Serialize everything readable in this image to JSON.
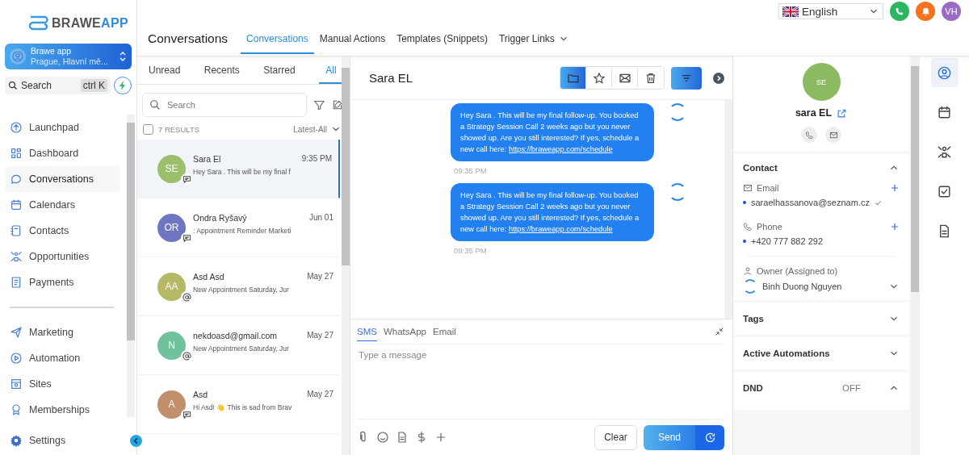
{
  "logo": {
    "main": "BRAWE",
    "accent": "APP"
  },
  "account": {
    "name": "Brawe app",
    "location": "Prague, Hlavní mě..."
  },
  "sidebar_search": {
    "placeholder": "Search",
    "shortcut": "ctrl K"
  },
  "nav_main": [
    {
      "label": "Launchpad",
      "selected": false
    },
    {
      "label": "Dashboard",
      "selected": false
    },
    {
      "label": "Conversations",
      "selected": true
    },
    {
      "label": "Calendars",
      "selected": false
    },
    {
      "label": "Contacts",
      "selected": false
    },
    {
      "label": "Opportunities",
      "selected": false
    },
    {
      "label": "Payments",
      "selected": false
    }
  ],
  "nav_secondary": [
    {
      "label": "Marketing",
      "selected": false
    },
    {
      "label": "Automation",
      "selected": false
    },
    {
      "label": "Sites",
      "selected": false
    },
    {
      "label": "Memberships",
      "selected": false
    }
  ],
  "settings": {
    "label": "Settings"
  },
  "header": {
    "title": "Conversations",
    "tabs": [
      {
        "label": "Conversations",
        "selected": true,
        "has_menu": false
      },
      {
        "label": "Manual Actions",
        "selected": false,
        "has_menu": false
      },
      {
        "label": "Templates (Snippets)",
        "selected": false,
        "has_menu": false
      },
      {
        "label": "Trigger Links",
        "selected": false,
        "has_menu": true
      }
    ]
  },
  "topbar": {
    "language": "English",
    "user_initials": "VH"
  },
  "list": {
    "tabs": [
      {
        "label": "Unread",
        "selected": false
      },
      {
        "label": "Recents",
        "selected": false
      },
      {
        "label": "Starred",
        "selected": false
      },
      {
        "label": "All",
        "selected": true
      }
    ],
    "search_placeholder": "Search",
    "select_all_checked": false,
    "results": "7 RESULTS",
    "sort": "Latest-All",
    "conversations": [
      {
        "initials": "SE",
        "name": "Sara El",
        "time": "9:35 PM",
        "preview": "Hey Sara . This will be my final f",
        "color": "#9bbf6a",
        "kind": "sms",
        "selected": true
      },
      {
        "initials": "OR",
        "name": "Ondra Ryšavý",
        "time": "Jun 01",
        "preview": ": Appointment Reminder Marketi",
        "color": "#6e76c2",
        "kind": "sms",
        "selected": false
      },
      {
        "initials": "AA",
        "name": "Asd Asd",
        "time": "May 27",
        "preview": "New Appointment Saturday, Jur",
        "color": "#b5b865",
        "kind": "email",
        "selected": false
      },
      {
        "initials": "N",
        "name": "nekdoasd@gmail.com",
        "time": "May 27",
        "preview": "New Appointment Saturday, Jur",
        "color": "#6fc29c",
        "kind": "email",
        "selected": false
      },
      {
        "initials": "A",
        "name": "Asd",
        "time": "May 27",
        "preview": "Hi Asd! 👋 This is sad from Brav",
        "color": "#c18f6b",
        "kind": "sms",
        "selected": false
      }
    ]
  },
  "chat": {
    "contact_name": "Sara EL",
    "messages": [
      {
        "text": "Hey Sara . This will be my final follow-up. You booked a Strategy Session Call 2 weeks ago but you never showed up. Are you still interested? If yes, schedule a new call here:",
        "link": "https://braweapp.com/schedule",
        "time": "09:35 PM"
      },
      {
        "text": "Hey Sara . This will be my final follow-up. You booked a Strategy Session Call 2 weeks ago but you never showed up. Are you still interested? If yes, schedule a new call here:",
        "link": "https://braweapp.com/schedule",
        "time": "09:35 PM"
      }
    ],
    "composer_tabs": [
      {
        "label": "SMS",
        "selected": true
      },
      {
        "label": "WhatsApp",
        "selected": false
      },
      {
        "label": "Email",
        "selected": false
      }
    ],
    "placeholder": "Type a message",
    "clear": "Clear",
    "send": "Send"
  },
  "contact": {
    "initials": "SE",
    "name": "sara EL",
    "section_title": "Contact",
    "email_label": "Email",
    "email": "saraelhassanova@seznam.cz",
    "phone_label": "Phone",
    "phone": "+420 777 882 292",
    "owner_label": "Owner (Assigned to)",
    "owner": "Binh Duong Nguyen",
    "collapsed": [
      {
        "title": "Tags",
        "expanded": false
      },
      {
        "title": "Active Automations",
        "expanded": false
      }
    ],
    "dnd": {
      "title": "DND",
      "value": "OFF",
      "expanded": true
    }
  },
  "rail": [
    {
      "selected": true
    },
    {
      "selected": false
    },
    {
      "selected": false
    },
    {
      "selected": false
    },
    {
      "selected": false
    }
  ]
}
